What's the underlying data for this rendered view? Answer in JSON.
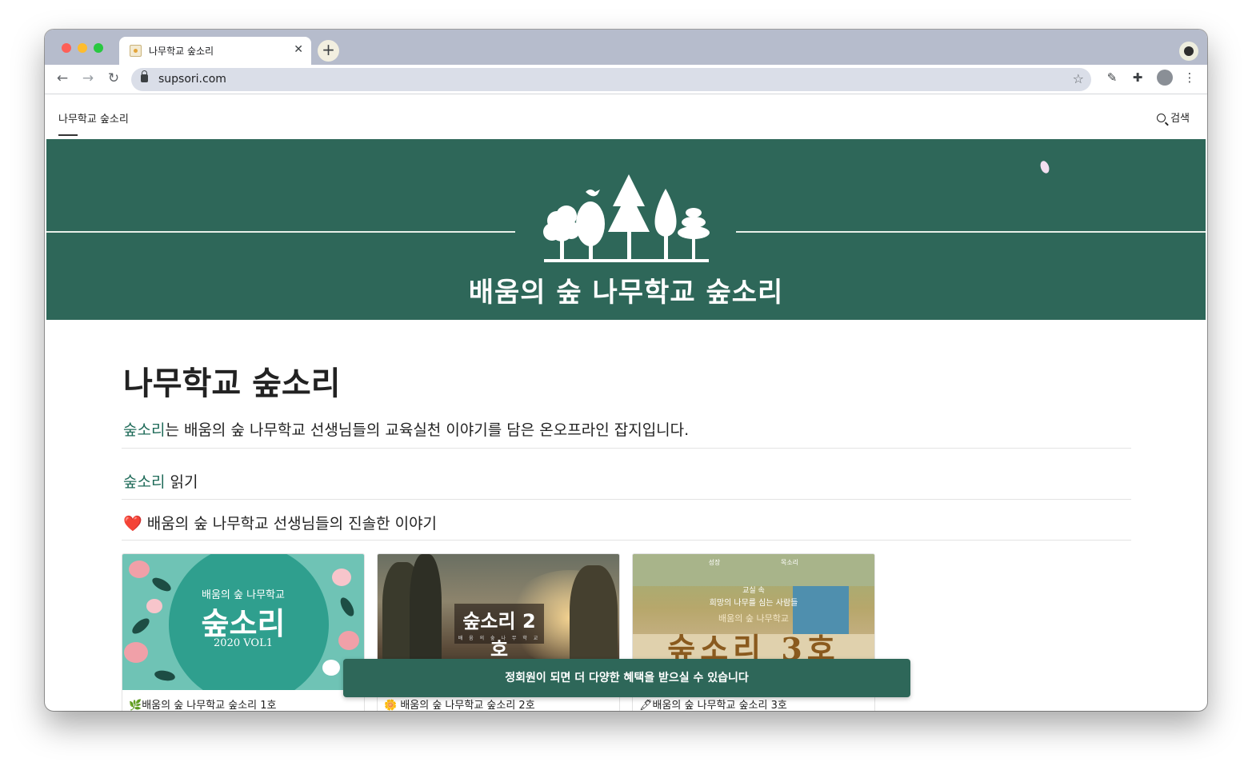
{
  "browser": {
    "tab_title": "나무학교 숲소리",
    "tab_close": "✕",
    "new_tab": "+",
    "url": "supsori.com"
  },
  "site_nav": {
    "brand": "나무학교 숲소리",
    "search_label": "검색"
  },
  "banner": {
    "title": "배움의 숲 나무학교 숲소리"
  },
  "main": {
    "page_title": "나무학교 숲소리",
    "intro_highlight": "숲소리",
    "intro_rest": "는 배움의 숲 나무학교 선생님들의 교육실천 이야기를 담은 온오프라인 잡지입니다.",
    "read_highlight": "숲소리",
    "read_rest": " 읽기",
    "story_heart": "❤️",
    "story_heading": " 배움의 숲 나무학교 선생님들의 진솔한 이야기"
  },
  "cards": [
    {
      "cover_sub": "배움의 숲 나무학교",
      "cover_main": "숲소리",
      "cover_vol": "2020 VOL1",
      "title_emoji": "🌿",
      "title": "배움의 숲 나무학교 숲소리 1호"
    },
    {
      "cover_main": "숲소리 2호",
      "cover_small": "배 움 의 숲 나 무 학 교",
      "title_emoji": "🌼",
      "title": "배움의 숲 나무학교 숲소리 2호"
    },
    {
      "cover_laurel_left": "성장",
      "cover_laurel_right": "목소리",
      "cover_line1": "교실 속",
      "cover_line2": "희망의 나무를 심는 사람들",
      "cover_line3": "배움의 숲 나무학교",
      "cover_main": "숲소리 3호",
      "title_emoji": "🖋",
      "title": "배움의 숲 나무학교 숲소리 3호"
    }
  ],
  "toast": {
    "message": "정회원이 되면 더 다양한 혜택을 받으실 수 있습니다"
  },
  "colors": {
    "brand_green": "#2e6759",
    "link_green": "#1f6b59"
  }
}
